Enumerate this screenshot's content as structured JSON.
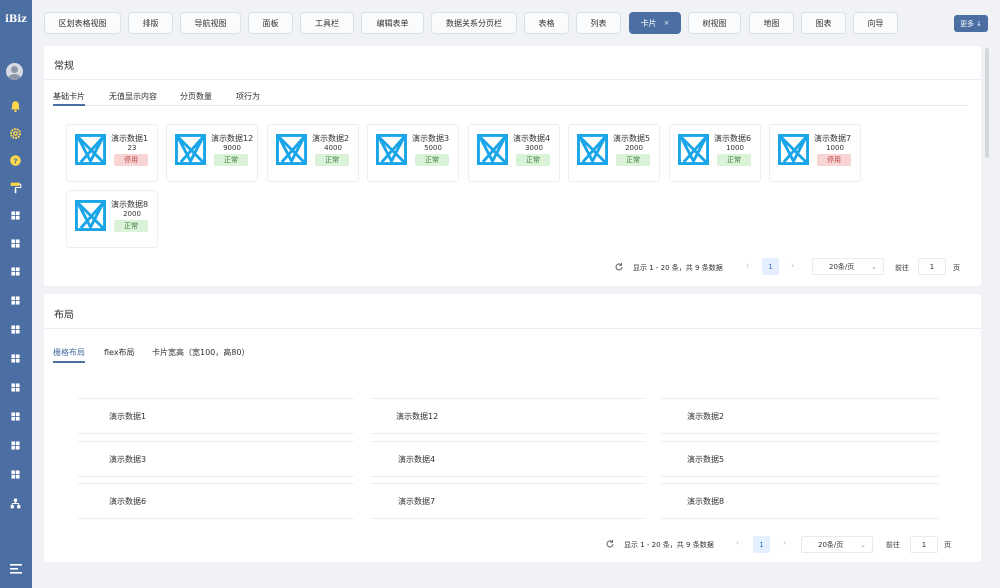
{
  "app": {
    "logo": "iBiz"
  },
  "sidebar": {
    "icons": [
      "user-avatar",
      "bell-icon",
      "gear-icon",
      "help-icon",
      "paint-roller-icon",
      "grid-icon",
      "grid-icon",
      "grid-icon",
      "grid-icon",
      "grid-icon",
      "grid-icon",
      "grid-icon",
      "grid-icon",
      "grid-icon",
      "grid-icon",
      "sitemap-icon",
      "menu-icon"
    ]
  },
  "tabs": [
    {
      "label": "区划表格视图"
    },
    {
      "label": "排版"
    },
    {
      "label": "导航视图"
    },
    {
      "label": "面板"
    },
    {
      "label": "工具栏"
    },
    {
      "label": "编辑表单"
    },
    {
      "label": "数据关系分页栏"
    },
    {
      "label": "表格"
    },
    {
      "label": "列表"
    },
    {
      "label": "卡片",
      "active": true,
      "close": "×"
    },
    {
      "label": "树视图"
    },
    {
      "label": "地图"
    },
    {
      "label": "图表"
    },
    {
      "label": "向导"
    }
  ],
  "more_button": "更多",
  "section1": {
    "title": "常规",
    "subtabs": [
      "基础卡片",
      "无值显示内容",
      "分页数量",
      "项行为"
    ],
    "cards": [
      {
        "name": "演示数据1",
        "value": "23",
        "status": "停用",
        "type": "stop"
      },
      {
        "name": "演示数据12",
        "value": "9000",
        "status": "正常",
        "type": "ok"
      },
      {
        "name": "演示数据2",
        "value": "4000",
        "status": "正常",
        "type": "ok"
      },
      {
        "name": "演示数据3",
        "value": "5000",
        "status": "正常",
        "type": "ok"
      },
      {
        "name": "演示数据4",
        "value": "3000",
        "status": "正常",
        "type": "ok"
      },
      {
        "name": "演示数据5",
        "value": "2000",
        "status": "正常",
        "type": "ok"
      },
      {
        "name": "演示数据6",
        "value": "1000",
        "status": "正常",
        "type": "ok"
      },
      {
        "name": "演示数据7",
        "value": "1000",
        "status": "停用",
        "type": "stop"
      },
      {
        "name": "演示数据8",
        "value": "2000",
        "status": "正常",
        "type": "ok"
      }
    ],
    "pager": {
      "summary": "显示 1 - 20 条，共 9 条数据",
      "prev": "‹",
      "page": "1",
      "next": "›",
      "size": "20条/页",
      "goto": "前往",
      "goto_value": "1",
      "goto_suffix": "页"
    }
  },
  "section2": {
    "title": "布局",
    "subtabs": [
      "栅格布局",
      "flex布局",
      "卡片宽高（宽100，高80）"
    ],
    "items": [
      "演示数据1",
      "演示数据12",
      "演示数据2",
      "演示数据3",
      "演示数据4",
      "演示数据5",
      "演示数据6",
      "演示数据7",
      "演示数据8"
    ],
    "pager": {
      "summary": "显示 1 - 20 条，共 9 条数据",
      "prev": "‹",
      "page": "1",
      "next": "›",
      "size": "20条/页",
      "goto": "前往",
      "goto_value": "1",
      "goto_suffix": "页"
    }
  },
  "colors": {
    "brand": "#4b6ea3",
    "ok_badge": "#d9f2d8",
    "stop_badge": "#f8d4d4",
    "card_icon": "#1aa5e8"
  }
}
